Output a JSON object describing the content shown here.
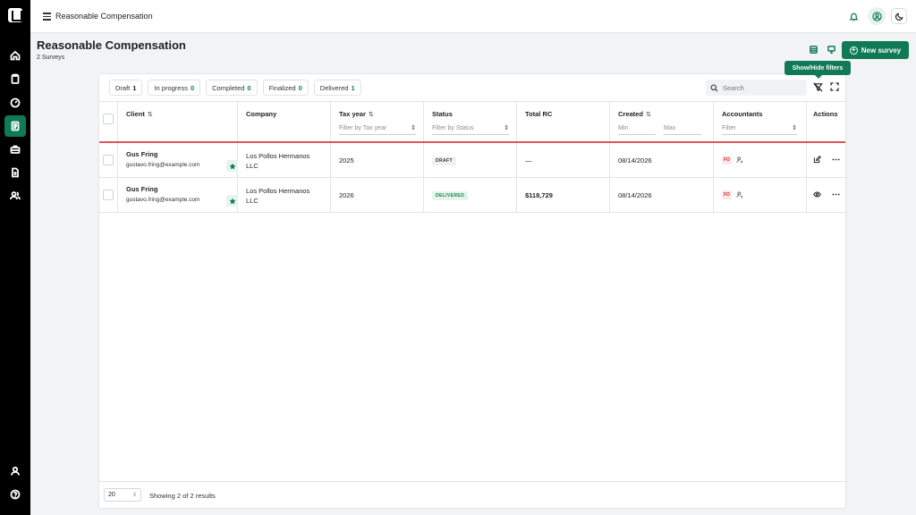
{
  "app": {
    "title": "Reasonable Compensation"
  },
  "page": {
    "title": "Reasonable Compensation",
    "subtitle": "2 Surveys",
    "new_button": "New survey"
  },
  "tooltip": "Show/Hide filters",
  "tabs": [
    {
      "label": "Draft",
      "count": "1"
    },
    {
      "label": "In progress",
      "count": "0"
    },
    {
      "label": "Completed",
      "count": "0"
    },
    {
      "label": "Finalized",
      "count": "0"
    },
    {
      "label": "Delivered",
      "count": "1"
    }
  ],
  "search": {
    "placeholder": "Search"
  },
  "columns": {
    "client": "Client",
    "company": "Company",
    "tax_year": "Tax year",
    "tax_year_filter": "Filter by Tax year",
    "status": "Status",
    "status_filter": "Filter by Status",
    "total_rc": "Total RC",
    "created": "Created",
    "created_min": "Min",
    "created_max": "Max",
    "accountants": "Accountants",
    "accountants_filter": "Filter",
    "actions": "Actions"
  },
  "rows": [
    {
      "client_name": "Gus Fring",
      "client_email": "gustavo.fring@example.com",
      "company_l1": "Los Pollos Hermanos",
      "company_l2": "LLC",
      "tax_year": "2025",
      "status": "DRAFT",
      "total_rc": "—",
      "created": "08/14/2026",
      "accountant_initials": "FO"
    },
    {
      "client_name": "Gus Fring",
      "client_email": "gustavo.fring@example.com",
      "company_l1": "Los Pollos Hermanos",
      "company_l2": "LLC",
      "tax_year": "2026",
      "status": "DELIVERED",
      "total_rc": "$118,729",
      "created": "08/14/2026",
      "accountant_initials": "FO"
    }
  ],
  "footer": {
    "page_size": "20",
    "showing": "Showing 2 of 2 results"
  },
  "colors": {
    "accent": "#0f7a55",
    "rail": "#000000",
    "sort_indicator": "#e05555"
  }
}
